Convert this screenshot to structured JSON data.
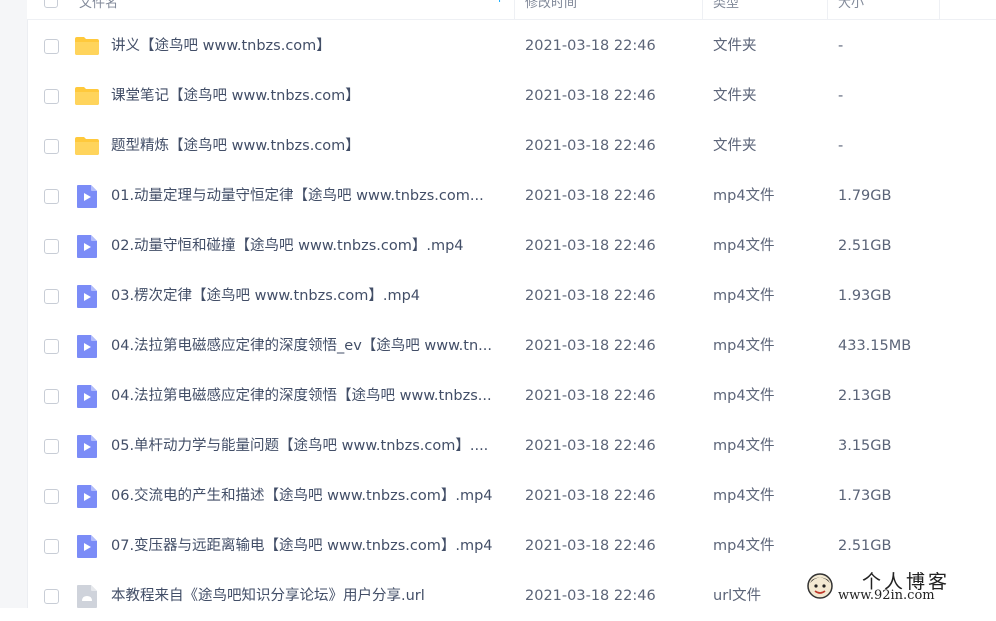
{
  "header": {
    "name_label": "文件名",
    "time_label": "修改时间",
    "type_label": "类型",
    "size_label": "大小"
  },
  "files": [
    {
      "icon": "folder-icon",
      "name": "讲义【途鸟吧 www.tnbzs.com】",
      "time": "2021-03-18 22:46",
      "type": "文件夹",
      "size": "-"
    },
    {
      "icon": "folder-icon",
      "name": "课堂笔记【途鸟吧 www.tnbzs.com】",
      "time": "2021-03-18 22:46",
      "type": "文件夹",
      "size": "-"
    },
    {
      "icon": "folder-icon",
      "name": "题型精炼【途鸟吧 www.tnbzs.com】",
      "time": "2021-03-18 22:46",
      "type": "文件夹",
      "size": "-"
    },
    {
      "icon": "video-file-icon",
      "name": "01.动量定理与动量守恒定律【途鸟吧 www.tnbzs.com...",
      "time": "2021-03-18 22:46",
      "type": "mp4文件",
      "size": "1.79GB"
    },
    {
      "icon": "video-file-icon",
      "name": "02.动量守恒和碰撞【途鸟吧 www.tnbzs.com】.mp4",
      "time": "2021-03-18 22:46",
      "type": "mp4文件",
      "size": "2.51GB"
    },
    {
      "icon": "video-file-icon",
      "name": "03.楞次定律【途鸟吧 www.tnbzs.com】.mp4",
      "time": "2021-03-18 22:46",
      "type": "mp4文件",
      "size": "1.93GB"
    },
    {
      "icon": "video-file-icon",
      "name": "04.法拉第电磁感应定律的深度领悟_ev【途鸟吧 www.tn...",
      "time": "2021-03-18 22:46",
      "type": "mp4文件",
      "size": "433.15MB"
    },
    {
      "icon": "video-file-icon",
      "name": "04.法拉第电磁感应定律的深度领悟【途鸟吧 www.tnbzs...",
      "time": "2021-03-18 22:46",
      "type": "mp4文件",
      "size": "2.13GB"
    },
    {
      "icon": "video-file-icon",
      "name": "05.单杆动力学与能量问题【途鸟吧 www.tnbzs.com】....",
      "time": "2021-03-18 22:46",
      "type": "mp4文件",
      "size": "3.15GB"
    },
    {
      "icon": "video-file-icon",
      "name": "06.交流电的产生和描述【途鸟吧 www.tnbzs.com】.mp4",
      "time": "2021-03-18 22:46",
      "type": "mp4文件",
      "size": "1.73GB"
    },
    {
      "icon": "video-file-icon",
      "name": "07.变压器与远距离输电【途鸟吧 www.tnbzs.com】.mp4",
      "time": "2021-03-18 22:46",
      "type": "mp4文件",
      "size": "2.51GB"
    },
    {
      "icon": "link-file-icon",
      "name": "本教程来自《途鸟吧知识分享论坛》用户分享.url",
      "time": "2021-03-18 22:46",
      "type": "url文件",
      "size": ""
    }
  ],
  "watermark": {
    "title": "个人博客",
    "url": "www.92in.com"
  },
  "colors": {
    "folder": "#ffc93c",
    "video": "#7b8cf7",
    "link": "#cfd3db",
    "accent": "#06a7ff"
  }
}
